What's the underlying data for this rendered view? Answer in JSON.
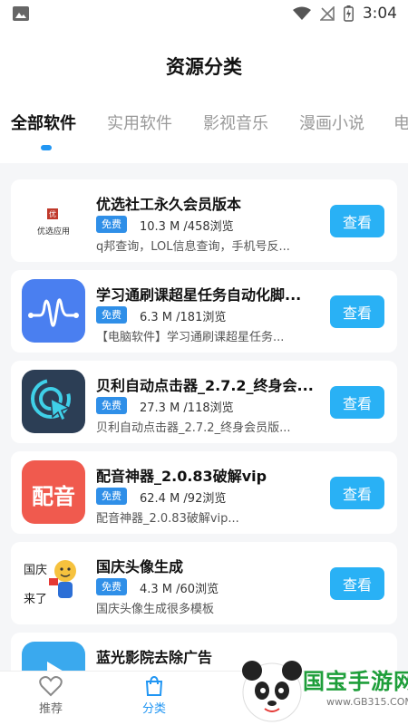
{
  "status_bar": {
    "time": "3:04"
  },
  "page": {
    "title": "资源分类"
  },
  "tabs": [
    {
      "label": "全部软件",
      "active": true
    },
    {
      "label": "实用软件",
      "active": false
    },
    {
      "label": "影视音乐",
      "active": false
    },
    {
      "label": "漫画小说",
      "active": false
    },
    {
      "label": "电",
      "active": false
    }
  ],
  "list": {
    "button_label": "查看",
    "items": [
      {
        "name": "优选社工永久会员版本",
        "badge": "免费",
        "meta": "10.3 M /458浏览",
        "desc": "q邦查询，LOL信息查询，手机号反...",
        "icon_name": "youxuan-logo-icon",
        "icon_caption": "优选应用"
      },
      {
        "name": "学习通刷课超星任务自动化脚...",
        "badge": "免费",
        "meta": "6.3 M /181浏览",
        "desc": "【电脑软件】学习通刷课超星任务...",
        "icon_name": "waveform-app-icon"
      },
      {
        "name": "贝利自动点击器_2.7.2_终身会...",
        "badge": "免费",
        "meta": "27.3 M /118浏览",
        "desc": "贝利自动点击器_2.7.2_终身会员版...",
        "icon_name": "auto-click-app-icon"
      },
      {
        "name": "配音神器_2.0.83破解vip",
        "badge": "免费",
        "meta": "62.4 M /92浏览",
        "desc": "配音神器_2.0.83破解vip...",
        "icon_name": "dubbing-app-icon",
        "icon_text": "配音"
      },
      {
        "name": "国庆头像生成",
        "badge": "免费",
        "meta": "4.3 M /60浏览",
        "desc": "国庆头像生成很多模板",
        "icon_name": "national-day-avatar-icon",
        "icon_text_1": "国庆",
        "icon_text_2": "来了"
      },
      {
        "name": "蓝光影院去除广告",
        "badge": "",
        "meta": "",
        "desc": "",
        "icon_name": "bluray-cinema-icon"
      }
    ]
  },
  "bottom_nav": [
    {
      "label": "推荐",
      "icon": "heart-icon",
      "active": false
    },
    {
      "label": "分类",
      "icon": "shopping-bag-icon",
      "active": true
    }
  ],
  "watermark": {
    "text": "国宝手游网",
    "url": "www.GB315.COM"
  },
  "colors": {
    "accent": "#2196f3",
    "button": "#29b1f5",
    "badge": "#2f8fe8",
    "list_bg": "#f5f6f8"
  }
}
